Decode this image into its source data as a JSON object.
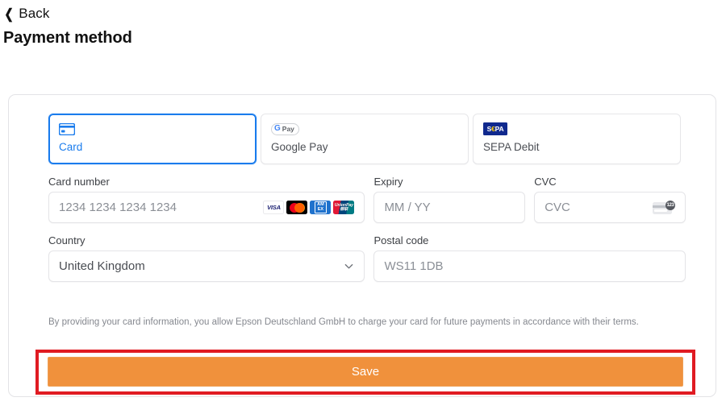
{
  "header": {
    "back_label": "Back",
    "back_icon": "chevron-left-icon",
    "title": "Payment method"
  },
  "payment_methods": {
    "selected": "Card",
    "tabs": [
      {
        "label": "Card",
        "icon": "credit-card-icon",
        "selected": true
      },
      {
        "label": "Google Pay",
        "icon": "google-pay-logo",
        "selected": false
      },
      {
        "label": "SEPA Debit",
        "icon": "sepa-logo",
        "selected": false
      }
    ]
  },
  "gpay_logo": {
    "g": "G",
    "pay": "Pay"
  },
  "sepa_logo": {
    "s": "S",
    "euro": "€",
    "pa": "PA"
  },
  "form": {
    "card_number": {
      "label": "Card number",
      "placeholder": "1234 1234 1234 1234",
      "value": ""
    },
    "expiry": {
      "label": "Expiry",
      "placeholder": "MM / YY",
      "value": ""
    },
    "cvc": {
      "label": "CVC",
      "placeholder": "CVC",
      "value": "",
      "hint_icon": "cvc-card-icon",
      "hint_digits": "123"
    },
    "country": {
      "label": "Country",
      "value": "United Kingdom",
      "chevron_icon": "chevron-down-icon"
    },
    "postal_code": {
      "label": "Postal code",
      "placeholder": "WS11 1DB",
      "value": ""
    }
  },
  "card_brands": [
    {
      "name": "visa-icon",
      "text": "VISA"
    },
    {
      "name": "mastercard-icon",
      "text": ""
    },
    {
      "name": "amex-icon",
      "line1": "AM",
      "line2": "EX"
    },
    {
      "name": "unionpay-icon",
      "line1": "UnionPay",
      "line2": "银联"
    }
  ],
  "disclaimer": "By providing your card information, you allow Epson Deutschland GmbH to charge your card for future payments in accordance with their terms.",
  "save_button": {
    "label": "Save"
  },
  "colors": {
    "accent_blue": "#1a7ced",
    "save_orange": "#f0913c",
    "highlight_red": "#e01b22",
    "border_grey": "#e4e4e7",
    "placeholder_grey": "#8b8f96"
  }
}
